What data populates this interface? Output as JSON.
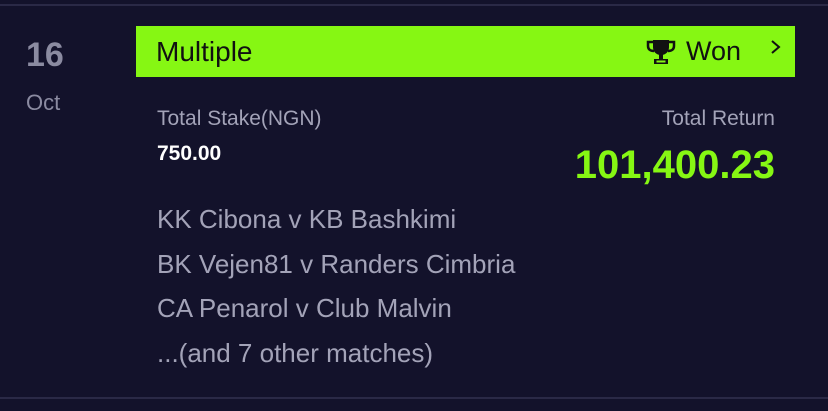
{
  "bet": {
    "date": {
      "day": "16",
      "month": "Oct"
    },
    "type": "Multiple",
    "status": {
      "label": "Won",
      "icon": "trophy-icon"
    },
    "stake": {
      "label": "Total Stake(NGN)",
      "value": "750.00"
    },
    "return": {
      "label": "Total Return",
      "value": "101,400.23"
    },
    "matches": [
      "KK Cibona v KB Bashkimi",
      "BK Vejen81 v Randers Cimbria",
      "CA Penarol v Club Malvin",
      "...(and 7 other matches)"
    ]
  },
  "colors": {
    "background": "#13122b",
    "accent": "#86f713",
    "muted_text": "#a3a3b8"
  }
}
